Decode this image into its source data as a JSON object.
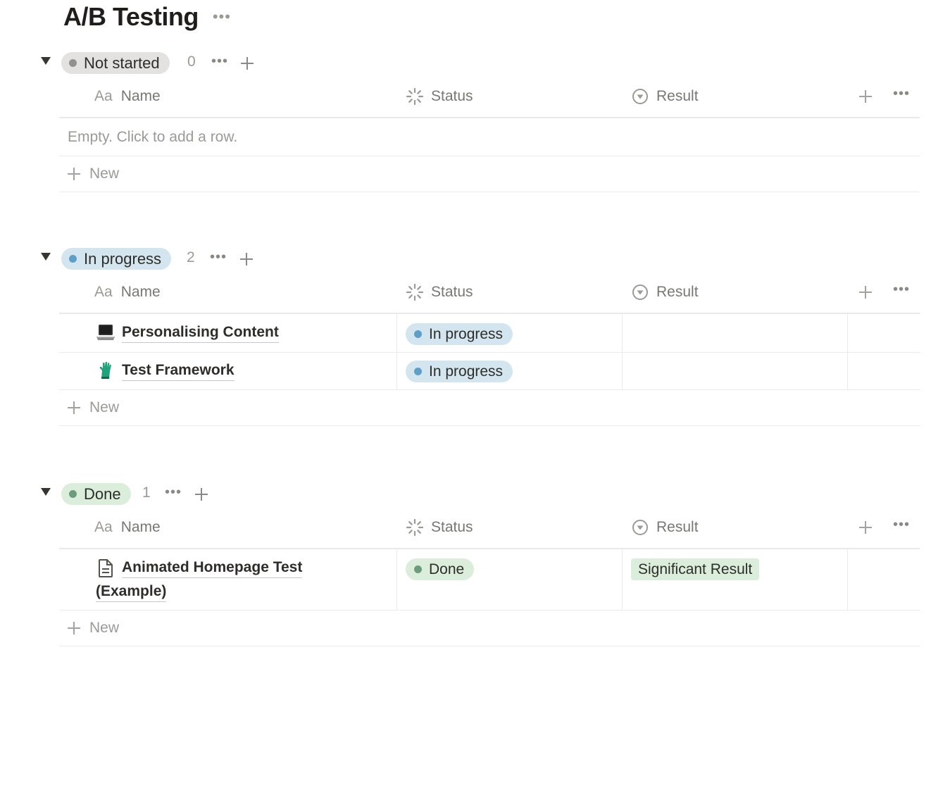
{
  "page": {
    "title": "A/B Testing"
  },
  "colors": {
    "not_started": "#e3e2e0",
    "not_started_dot": "#91918e",
    "in_progress": "#d3e5ef",
    "in_progress_dot": "#5e9fc7",
    "done": "#dbeddb",
    "done_dot": "#6c9b7d"
  },
  "columns": {
    "name": "Name",
    "status": "Status",
    "result": "Result",
    "name_prefix": "Aa"
  },
  "new_label": "New",
  "groups": [
    {
      "label": "Not started",
      "count": "0",
      "empty_text": "Empty. Click to add a row.",
      "rows": []
    },
    {
      "label": "In progress",
      "count": "2",
      "rows": [
        {
          "icon": "laptop-icon",
          "name": "Personalising Content",
          "status": "In progress",
          "result": ""
        },
        {
          "icon": "glove-icon",
          "name": "Test Framework",
          "status": "In progress",
          "result": ""
        }
      ]
    },
    {
      "label": "Done",
      "count": "1",
      "rows": [
        {
          "icon": "page-icon",
          "name_line1": "Animated Homepage Test",
          "name_line2": "(Example)",
          "status": "Done",
          "result": "Significant Result"
        }
      ]
    }
  ]
}
